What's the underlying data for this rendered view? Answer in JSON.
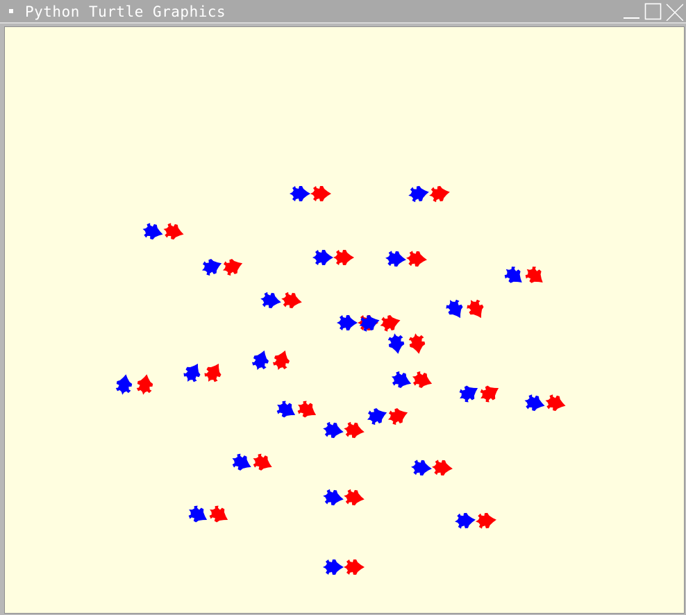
{
  "window": {
    "title": "Python Turtle Graphics",
    "controls": [
      "minimize",
      "maximize",
      "close"
    ]
  },
  "canvas": {
    "background": "#fffee0",
    "turtle_colors": {
      "blue": "#0000ff",
      "red": "#ff0000"
    },
    "turtle_pair_count": 30
  }
}
